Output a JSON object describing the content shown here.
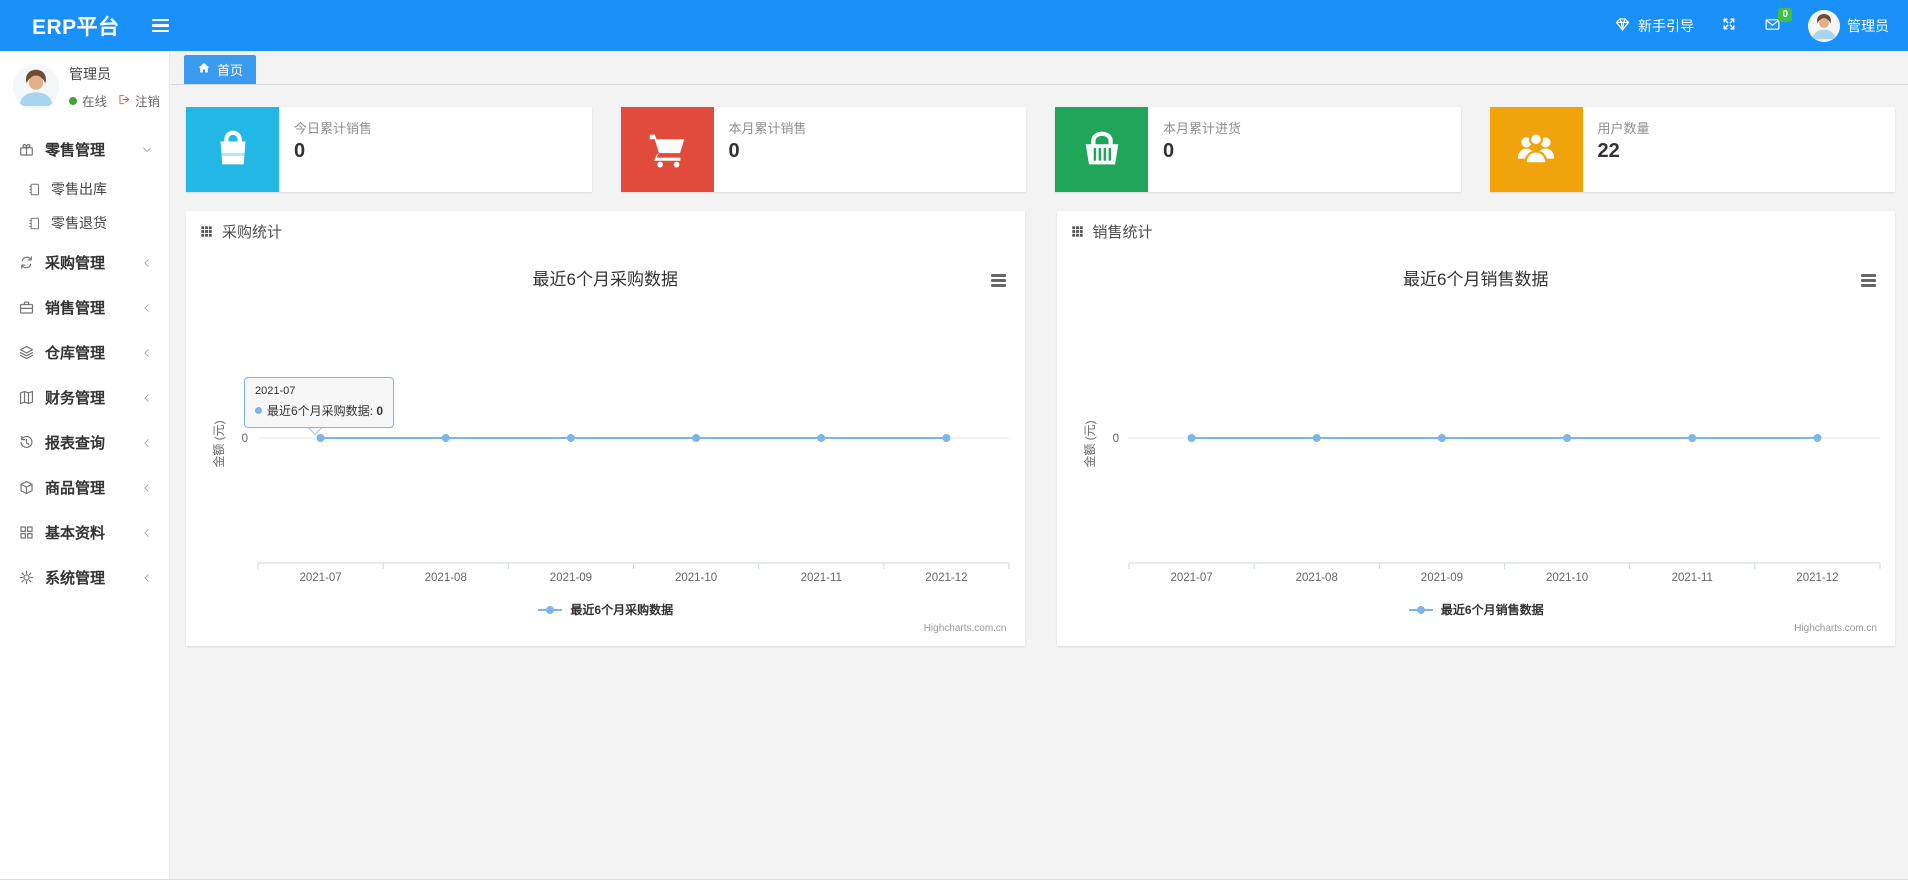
{
  "colors": {
    "navbar_bg": "#1a91f8",
    "tab_bg": "#3a9bf0",
    "badge_bg": "#3fbf45",
    "series_line": "#7cb5ec"
  },
  "navbar": {
    "brand": "ERP平台",
    "guide_label": "新手引导",
    "message_badge": "0",
    "user_name": "管理员"
  },
  "sidebar": {
    "user": {
      "name": "管理员",
      "status_label": "在线",
      "logout_label": "注销"
    },
    "menu": [
      {
        "key": "retail",
        "label": "零售管理",
        "icon": "gift-icon",
        "expanded": true,
        "children": [
          {
            "key": "retail-outbound",
            "label": "零售出库",
            "icon": "notebook-icon"
          },
          {
            "key": "retail-return",
            "label": "零售退货",
            "icon": "notebook-icon"
          }
        ]
      },
      {
        "key": "purchase",
        "label": "采购管理",
        "icon": "repeat-icon"
      },
      {
        "key": "sales",
        "label": "销售管理",
        "icon": "briefcase-icon"
      },
      {
        "key": "warehouse",
        "label": "仓库管理",
        "icon": "layers-icon"
      },
      {
        "key": "finance",
        "label": "财务管理",
        "icon": "book-icon"
      },
      {
        "key": "reports",
        "label": "报表查询",
        "icon": "history-icon"
      },
      {
        "key": "goods",
        "label": "商品管理",
        "icon": "dropbox-icon"
      },
      {
        "key": "basic",
        "label": "基本资料",
        "icon": "grid-icon"
      },
      {
        "key": "system",
        "label": "系统管理",
        "icon": "gear-icon"
      }
    ]
  },
  "tabs": {
    "home_label": "首页"
  },
  "stat_cards": [
    {
      "key": "today-sales",
      "title": "今日累计销售",
      "value": "0",
      "color": "#23b7e5",
      "icon": "bag-icon"
    },
    {
      "key": "month-sales",
      "title": "本月累计销售",
      "value": "0",
      "color": "#e04b3b",
      "icon": "cart-icon"
    },
    {
      "key": "month-purchase",
      "title": "本月累计进货",
      "value": "0",
      "color": "#1fa65a",
      "icon": "basket-icon"
    },
    {
      "key": "user-count",
      "title": "用户数量",
      "value": "22",
      "color": "#f0a30a",
      "icon": "users-icon"
    }
  ],
  "chart_data": [
    {
      "key": "purchase",
      "type": "line",
      "panel_title": "采购统计",
      "title": "最近6个月采购数据",
      "x": [
        "2021-07",
        "2021-08",
        "2021-09",
        "2021-10",
        "2021-11",
        "2021-12"
      ],
      "series": [
        {
          "name": "最近6个月采购数据",
          "values": [
            0,
            0,
            0,
            0,
            0,
            0
          ],
          "color": "#7cb5ec"
        }
      ],
      "ylabel": "金额 (元)",
      "yticks": [
        "0"
      ],
      "grid": true,
      "legend_position": "bottom",
      "credits": "Highcharts.com.cn",
      "tooltip": {
        "category": "2021-07",
        "series": "最近6个月采购数据",
        "value": "0"
      }
    },
    {
      "key": "sales",
      "type": "line",
      "panel_title": "销售统计",
      "title": "最近6个月销售数据",
      "x": [
        "2021-07",
        "2021-08",
        "2021-09",
        "2021-10",
        "2021-11",
        "2021-12"
      ],
      "series": [
        {
          "name": "最近6个月销售数据",
          "values": [
            0,
            0,
            0,
            0,
            0,
            0
          ],
          "color": "#7cb5ec"
        }
      ],
      "ylabel": "金额 (元)",
      "yticks": [
        "0"
      ],
      "grid": true,
      "legend_position": "bottom",
      "credits": "Highcharts.com.cn"
    }
  ]
}
